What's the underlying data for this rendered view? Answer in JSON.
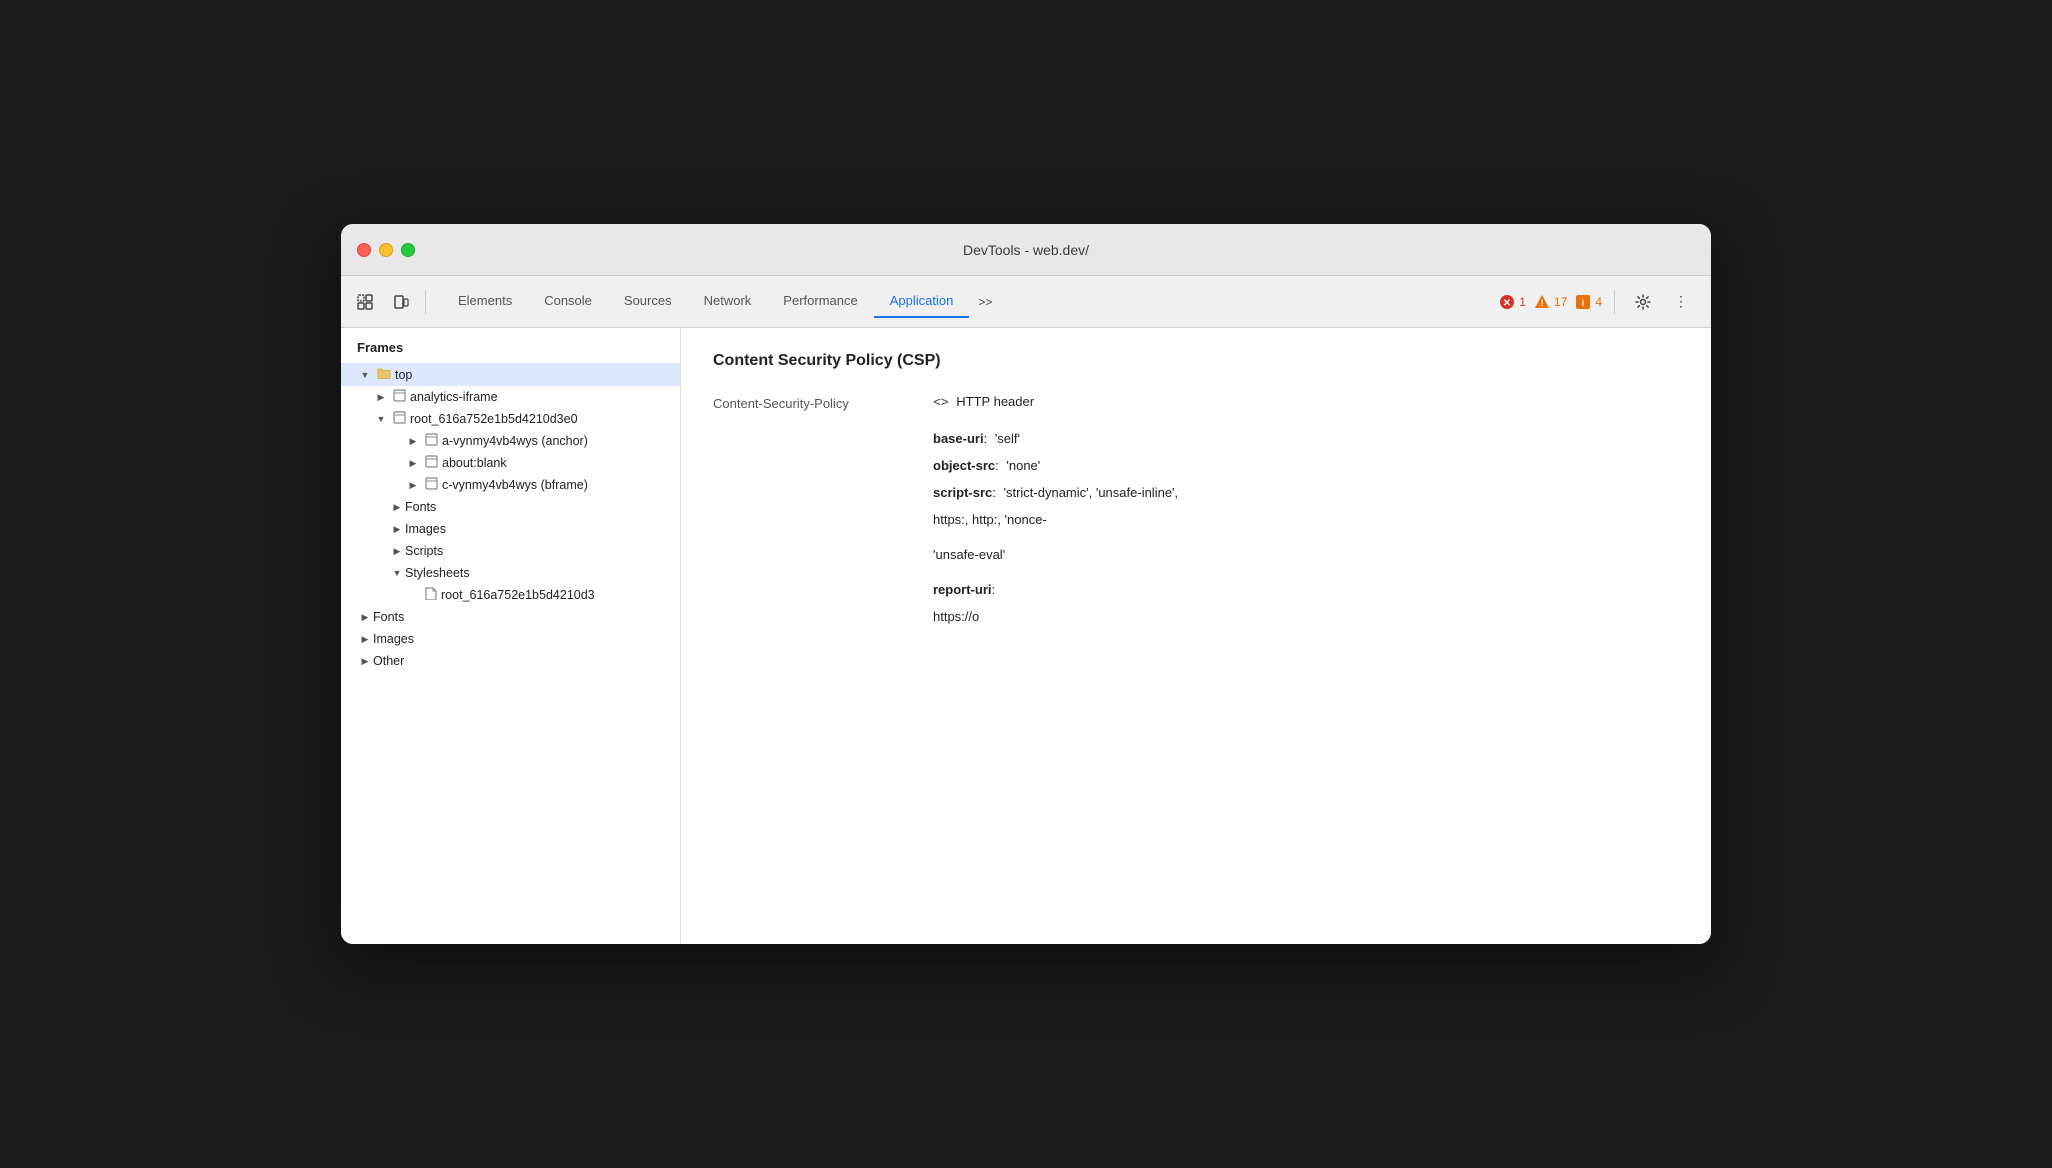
{
  "window": {
    "title": "DevTools - web.dev/"
  },
  "toolbar": {
    "tabs": [
      {
        "id": "elements",
        "label": "Elements",
        "active": false
      },
      {
        "id": "console",
        "label": "Console",
        "active": false
      },
      {
        "id": "sources",
        "label": "Sources",
        "active": false
      },
      {
        "id": "network",
        "label": "Network",
        "active": false
      },
      {
        "id": "performance",
        "label": "Performance",
        "active": false
      },
      {
        "id": "application",
        "label": "Application",
        "active": true
      }
    ],
    "more_tabs_label": ">>",
    "errors_count": "1",
    "warnings_count": "17",
    "info_count": "4"
  },
  "sidebar": {
    "header": "Frames",
    "items": [
      {
        "id": "top",
        "label": "top",
        "level": 0,
        "expanded": true,
        "selected": true,
        "has_icon": true,
        "icon_type": "folder"
      },
      {
        "id": "analytics-iframe",
        "label": "analytics-iframe",
        "level": 1,
        "expanded": false,
        "has_icon": true,
        "icon_type": "frame"
      },
      {
        "id": "root_616a",
        "label": "root_616a752e1b5d4210d3e0",
        "level": 1,
        "expanded": true,
        "has_icon": true,
        "icon_type": "frame"
      },
      {
        "id": "a-vynmy4vb4wys",
        "label": "a-vynmy4vb4wys (anchor)",
        "level": 2,
        "expanded": false,
        "has_icon": true,
        "icon_type": "frame"
      },
      {
        "id": "about-blank",
        "label": "about:blank",
        "level": 2,
        "expanded": false,
        "has_icon": true,
        "icon_type": "frame"
      },
      {
        "id": "c-vynmy4vb4wys",
        "label": "c-vynmy4vb4wys (bframe)",
        "level": 2,
        "expanded": false,
        "has_icon": true,
        "icon_type": "frame"
      },
      {
        "id": "fonts-sub",
        "label": "Fonts",
        "level": 2,
        "expanded": false,
        "has_icon": false
      },
      {
        "id": "images-sub",
        "label": "Images",
        "level": 2,
        "expanded": false,
        "has_icon": false
      },
      {
        "id": "scripts-sub",
        "label": "Scripts",
        "level": 2,
        "expanded": false,
        "has_icon": false
      },
      {
        "id": "stylesheets-sub",
        "label": "Stylesheets",
        "level": 2,
        "expanded": true,
        "has_icon": false
      },
      {
        "id": "root_file",
        "label": "root_616a752e1b5d4210d3",
        "level": 3,
        "expanded": false,
        "has_icon": true,
        "icon_type": "file"
      },
      {
        "id": "fonts-top",
        "label": "Fonts",
        "level": 0,
        "expanded": false,
        "has_icon": false
      },
      {
        "id": "images-top",
        "label": "Images",
        "level": 0,
        "expanded": false,
        "has_icon": false
      },
      {
        "id": "other-top",
        "label": "Other",
        "level": 0,
        "expanded": false,
        "has_icon": false
      }
    ]
  },
  "content": {
    "title": "Content Security Policy (CSP)",
    "header_key": "Content-Security-Policy",
    "header_value_icon": "<>",
    "header_value_text": "HTTP header",
    "directives": [
      {
        "id": "base-uri",
        "name": "base-uri",
        "value": "'self'"
      },
      {
        "id": "object-src",
        "name": "object-src",
        "value": "'none'"
      },
      {
        "id": "script-src",
        "name": "script-src",
        "value": "'strict-dynamic', 'unsafe-inline',"
      },
      {
        "id": "script-src-2",
        "name": "",
        "value": "https:, http:, 'nonce-"
      },
      {
        "id": "unsafe-eval",
        "name": "",
        "value": "'unsafe-eval'"
      },
      {
        "id": "report-uri",
        "name": "report-uri",
        "value": ""
      },
      {
        "id": "report-uri-val",
        "name": "",
        "value": "https://o"
      }
    ]
  }
}
